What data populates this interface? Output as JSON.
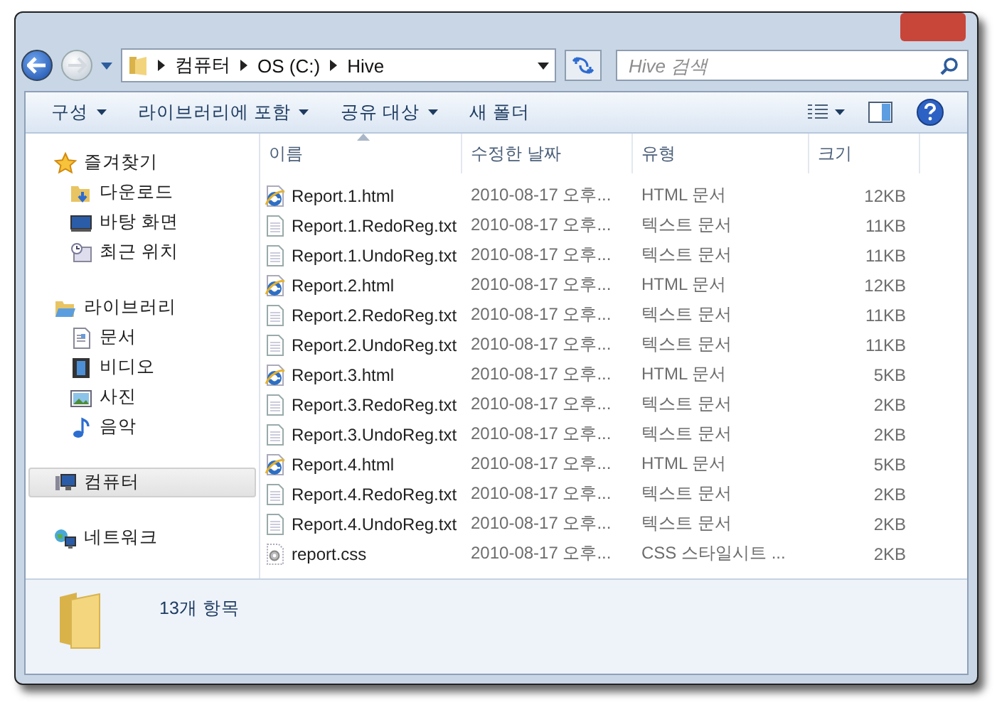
{
  "address": {
    "crumbs": [
      "컴퓨터",
      "OS (C:)",
      "Hive"
    ]
  },
  "search": {
    "placeholder": "Hive 검색"
  },
  "toolbar": {
    "buttons": [
      {
        "label": "구성",
        "dropdown": true
      },
      {
        "label": "라이브러리에 포함",
        "dropdown": true
      },
      {
        "label": "공유 대상",
        "dropdown": true
      },
      {
        "label": "새 폴더",
        "dropdown": false
      }
    ]
  },
  "sidebar": {
    "groups": [
      {
        "label": "즐겨찾기",
        "kind": "star",
        "selected": false,
        "children": [
          {
            "label": "다운로드",
            "kind": "download",
            "selected": false
          },
          {
            "label": "바탕 화면",
            "kind": "desktop",
            "selected": false
          },
          {
            "label": "최근 위치",
            "kind": "recent",
            "selected": false
          }
        ]
      },
      {
        "label": "라이브러리",
        "kind": "library",
        "selected": false,
        "children": [
          {
            "label": "문서",
            "kind": "document",
            "selected": false
          },
          {
            "label": "비디오",
            "kind": "video",
            "selected": false
          },
          {
            "label": "사진",
            "kind": "picture",
            "selected": false
          },
          {
            "label": "음악",
            "kind": "music",
            "selected": false
          }
        ]
      },
      {
        "label": "컴퓨터",
        "kind": "computer",
        "selected": true
      },
      {
        "label": "네트워크",
        "kind": "network",
        "selected": false
      }
    ]
  },
  "table": {
    "columns": [
      "이름",
      "수정한 날짜",
      "유형",
      "크기"
    ],
    "rows": [
      {
        "kind": "html",
        "name": "Report.1.html",
        "date": "2010-08-17 오후...",
        "type": "HTML 문서",
        "size": "12KB"
      },
      {
        "kind": "txt",
        "name": "Report.1.RedoReg.txt",
        "date": "2010-08-17 오후...",
        "type": "텍스트 문서",
        "size": "11KB"
      },
      {
        "kind": "txt",
        "name": "Report.1.UndoReg.txt",
        "date": "2010-08-17 오후...",
        "type": "텍스트 문서",
        "size": "11KB"
      },
      {
        "kind": "html",
        "name": "Report.2.html",
        "date": "2010-08-17 오후...",
        "type": "HTML 문서",
        "size": "12KB"
      },
      {
        "kind": "txt",
        "name": "Report.2.RedoReg.txt",
        "date": "2010-08-17 오후...",
        "type": "텍스트 문서",
        "size": "11KB"
      },
      {
        "kind": "txt",
        "name": "Report.2.UndoReg.txt",
        "date": "2010-08-17 오후...",
        "type": "텍스트 문서",
        "size": "11KB"
      },
      {
        "kind": "html",
        "name": "Report.3.html",
        "date": "2010-08-17 오후...",
        "type": "HTML 문서",
        "size": "5KB"
      },
      {
        "kind": "txt",
        "name": "Report.3.RedoReg.txt",
        "date": "2010-08-17 오후...",
        "type": "텍스트 문서",
        "size": "2KB"
      },
      {
        "kind": "txt",
        "name": "Report.3.UndoReg.txt",
        "date": "2010-08-17 오후...",
        "type": "텍스트 문서",
        "size": "2KB"
      },
      {
        "kind": "html",
        "name": "Report.4.html",
        "date": "2010-08-17 오후...",
        "type": "HTML 문서",
        "size": "5KB"
      },
      {
        "kind": "txt",
        "name": "Report.4.RedoReg.txt",
        "date": "2010-08-17 오후...",
        "type": "텍스트 문서",
        "size": "2KB"
      },
      {
        "kind": "txt",
        "name": "Report.4.UndoReg.txt",
        "date": "2010-08-17 오후...",
        "type": "텍스트 문서",
        "size": "2KB"
      },
      {
        "kind": "css",
        "name": "report.css",
        "date": "2010-08-17 오후...",
        "type": "CSS 스타일시트 ...",
        "size": "2KB"
      }
    ]
  },
  "status_bar": {
    "text": "13개 항목"
  }
}
